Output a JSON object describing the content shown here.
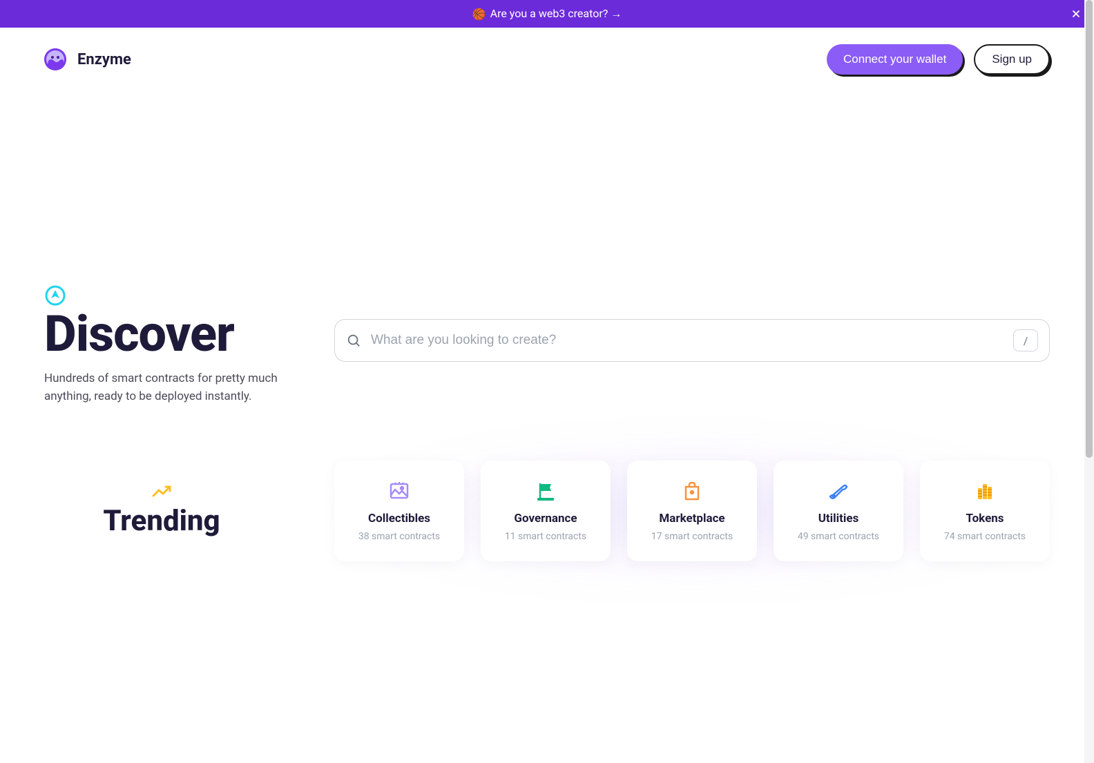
{
  "banner": {
    "emoji": "🏀",
    "text": "Are you a web3 creator? →"
  },
  "header": {
    "brand": "Enzyme",
    "connect_label": "Connect your wallet",
    "signup_label": "Sign up"
  },
  "discover": {
    "title": "Discover",
    "subtitle": "Hundreds of smart contracts for pretty much anything, ready to be deployed instantly."
  },
  "search": {
    "placeholder": "What are you looking to create?",
    "shortcut": "/"
  },
  "trending": {
    "title": "Trending",
    "categories": [
      {
        "name": "Collectibles",
        "count": "38 smart contracts",
        "icon": "image",
        "color": "#a78bfa"
      },
      {
        "name": "Governance",
        "count": "11 smart contracts",
        "icon": "flag",
        "color": "#34d399"
      },
      {
        "name": "Marketplace",
        "count": "17 smart contracts",
        "icon": "bag",
        "color": "#fb923c"
      },
      {
        "name": "Utilities",
        "count": "49 smart contracts",
        "icon": "wrench",
        "color": "#60a5fa"
      },
      {
        "name": "Tokens",
        "count": "74 smart contracts",
        "icon": "coins",
        "color": "#fbbf24"
      }
    ]
  }
}
